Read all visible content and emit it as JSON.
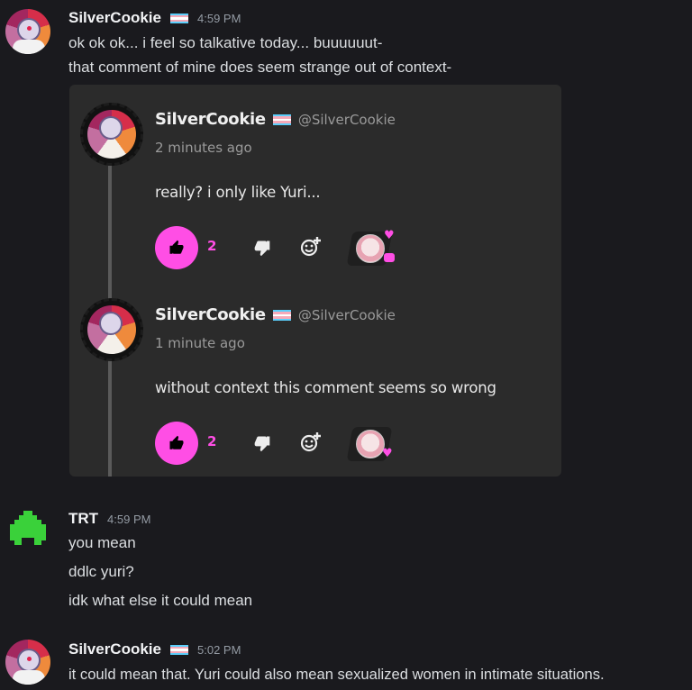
{
  "messages": [
    {
      "username": "SilverCookie",
      "time": "4:59 PM",
      "lines": [
        "ok ok ok... i feel so talkative today... buuuuuut-",
        "that comment of mine does seem strange out of context-"
      ],
      "embed": {
        "comments": [
          {
            "username": "SilverCookie",
            "handle": "@SilverCookie",
            "time": "2 minutes ago",
            "text": "really? i only like Yuri...",
            "likes": "2"
          },
          {
            "username": "SilverCookie",
            "handle": "@SilverCookie",
            "time": "1 minute ago",
            "text": "without context this comment seems so wrong",
            "likes": "2"
          }
        ]
      }
    },
    {
      "username": "TRT",
      "time": "4:59 PM",
      "lines": [
        "you mean",
        "ddlc yuri?",
        "idk what else it could mean"
      ]
    },
    {
      "username": "SilverCookie",
      "time": "5:02 PM",
      "lines": [
        "it could mean that. Yuri could also mean sexualized women in intimate situations."
      ]
    }
  ],
  "colors": {
    "background": "#1a1a1e",
    "embed": "#2b2b2b",
    "accent_pink": "#ff4ee5",
    "trt_green": "#3ad13a",
    "flag_blue": "#5bcefa",
    "flag_pink": "#f5a9b8",
    "flag_white": "#ffffff"
  },
  "icons": [
    "trans-flag-icon",
    "like-icon",
    "dislike-icon",
    "add-emoji-icon",
    "heart-icon",
    "chat-bubble-icon"
  ]
}
